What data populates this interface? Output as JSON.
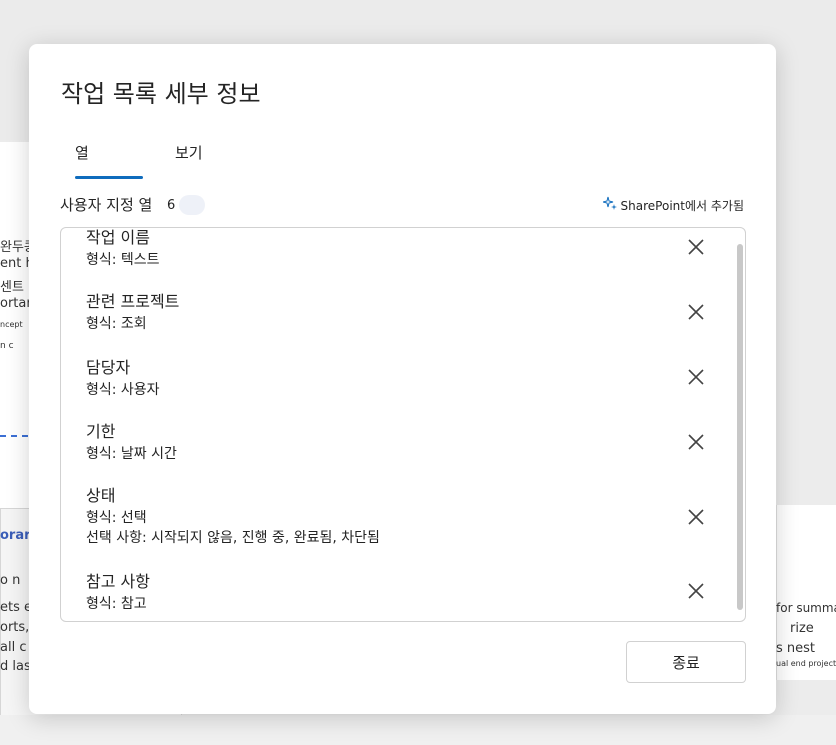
{
  "background": {
    "left_fragments": [
      "완두콩",
      "ent h",
      "센트",
      "ortar",
      "ncept",
      "n c",
      "orary",
      "o n",
      "ets e",
      "orts,",
      "all  c",
      "d las"
    ],
    "right_fragments": [
      "for summa",
      "rize",
      "s  nest",
      "ual end project"
    ]
  },
  "dialog": {
    "title": "작업 목록 세부 정보",
    "tabs": [
      {
        "label": "열",
        "selected": true
      },
      {
        "label": "보기",
        "selected": false
      }
    ],
    "section_label": "사용자 지정 열",
    "column_count": "6",
    "sharepoint_added": "SharePoint에서 추가됨",
    "columns": [
      {
        "name": "작업 이름",
        "type": "형식: 텍스트"
      },
      {
        "name": "관련 프로젝트",
        "type": "형식: 조회"
      },
      {
        "name": "담당자",
        "type": "형식: 사용자"
      },
      {
        "name": "기한",
        "type": "형식: 날짜 시간"
      },
      {
        "name": "상태",
        "type": "형식: 선택",
        "choices": "선택 사항: 시작되지 않음, 진행 중, 완료됨, 차단됨"
      },
      {
        "name": "참고 사항",
        "type": "형식: 참고"
      }
    ],
    "close_label": "종료"
  },
  "colors": {
    "accent": "#0f6cbd",
    "border": "#d1d1d1"
  }
}
